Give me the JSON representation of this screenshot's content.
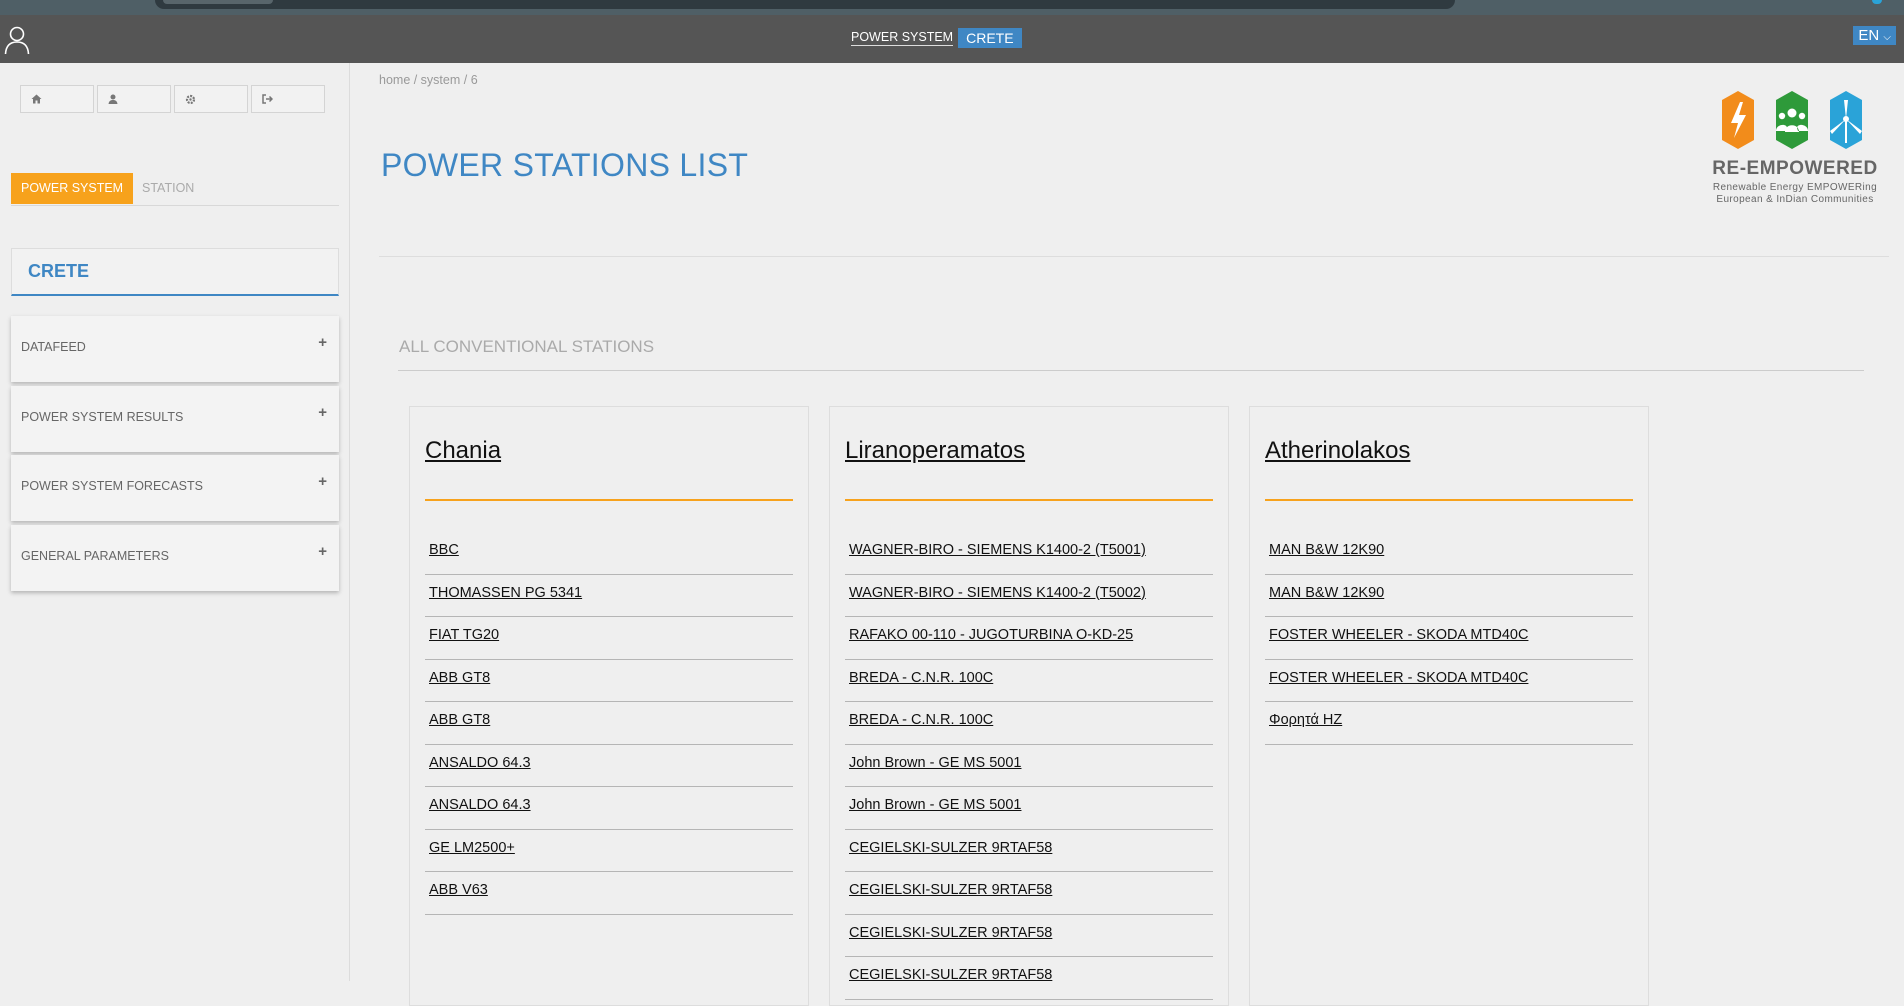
{
  "header": {
    "label": "POWER SYSTEM",
    "badge": "CRETE",
    "lang": "EN"
  },
  "sidebar": {
    "icon_buttons": [
      "home-icon",
      "user-icon",
      "gear-icon",
      "sign-out-icon"
    ],
    "tabs": {
      "active": "POWER SYSTEM",
      "inactive": "STATION"
    },
    "system_name": "CRETE",
    "accordions": [
      {
        "label": "DATAFEED",
        "icon": "+"
      },
      {
        "label": "POWER SYSTEM RESULTS",
        "icon": "+"
      },
      {
        "label": "POWER SYSTEM FORECASTS",
        "icon": "+"
      },
      {
        "label": "GENERAL PARAMETERS",
        "icon": "+"
      }
    ]
  },
  "main": {
    "breadcrumb": "home / system / 6",
    "title": "POWER STATIONS LIST",
    "section_title": "ALL CONVENTIONAL STATIONS",
    "logo": {
      "title": "RE-EMPOWERED",
      "subtitle1": "Renewable Energy EMPOWERing",
      "subtitle2": "European & InDian Communities",
      "colors": [
        "#f28c1b",
        "#2e9a3a",
        "#2aa3d8"
      ]
    },
    "stations": [
      {
        "name": "Chania",
        "units": [
          "BBC",
          "THOMASSEN PG 5341",
          "FIAT TG20",
          "ABB GT8",
          "ABB GT8",
          "ANSALDO 64.3",
          "ANSALDO 64.3",
          "GE LM2500+",
          "ABB V63"
        ]
      },
      {
        "name": "Liranoperamatos",
        "units": [
          "WAGNER-BIRO - SIEMENS K1400-2 (T5001)",
          "WAGNER-BIRO - SIEMENS K1400-2 (T5002)",
          "RAFAKO 00-110 - JUGOTURBINA O-KD-25",
          "BREDA - C.N.R. 100C",
          "BREDA - C.N.R. 100C",
          "John Brown - GE MS 5001",
          "John Brown - GE MS 5001",
          "CEGIELSKI-SULZER 9RTAF58",
          "CEGIELSKI-SULZER 9RTAF58",
          "CEGIELSKI-SULZER 9RTAF58",
          "CEGIELSKI-SULZER 9RTAF58"
        ]
      },
      {
        "name": "Atherinolakos",
        "units": [
          "MAN B&W 12K90",
          "MAN B&W 12K90",
          "FOSTER WHEELER - SKODA MTD40C",
          "FOSTER WHEELER - SKODA MTD40C",
          "Φορητά HZ"
        ]
      }
    ]
  }
}
